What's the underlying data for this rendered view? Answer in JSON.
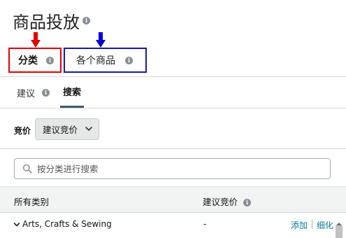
{
  "page": {
    "title": "商品投放"
  },
  "tabs_primary": [
    {
      "label": "分类",
      "selected": true
    },
    {
      "label": "各个商品",
      "selected": false
    }
  ],
  "tabs_secondary": [
    {
      "label": "建议",
      "selected": false
    },
    {
      "label": "搜索",
      "selected": true
    }
  ],
  "bid": {
    "label": "竞价",
    "selected_value": "建议竞价"
  },
  "search": {
    "placeholder": "按分类进行搜索",
    "value": ""
  },
  "table": {
    "headers": {
      "category": "所有类别",
      "suggested_bid": "建议竞价"
    },
    "rows": [
      {
        "name": "Arts, Crafts & Sewing",
        "bid": "-",
        "add_label": "添加",
        "refine_label": "细化"
      }
    ]
  },
  "annotations": {
    "arrow_red_color": "#e00000",
    "arrow_blue_color": "#0000dd"
  },
  "icons": {
    "info": "info-icon",
    "search": "search-icon",
    "chevron_down": "chevron-down-icon"
  },
  "colors": {
    "link": "#0a7c9b",
    "active_tab_underline": "#3d5a6c",
    "highlight_red": "#e00000",
    "highlight_blue": "#1a1aa0"
  }
}
